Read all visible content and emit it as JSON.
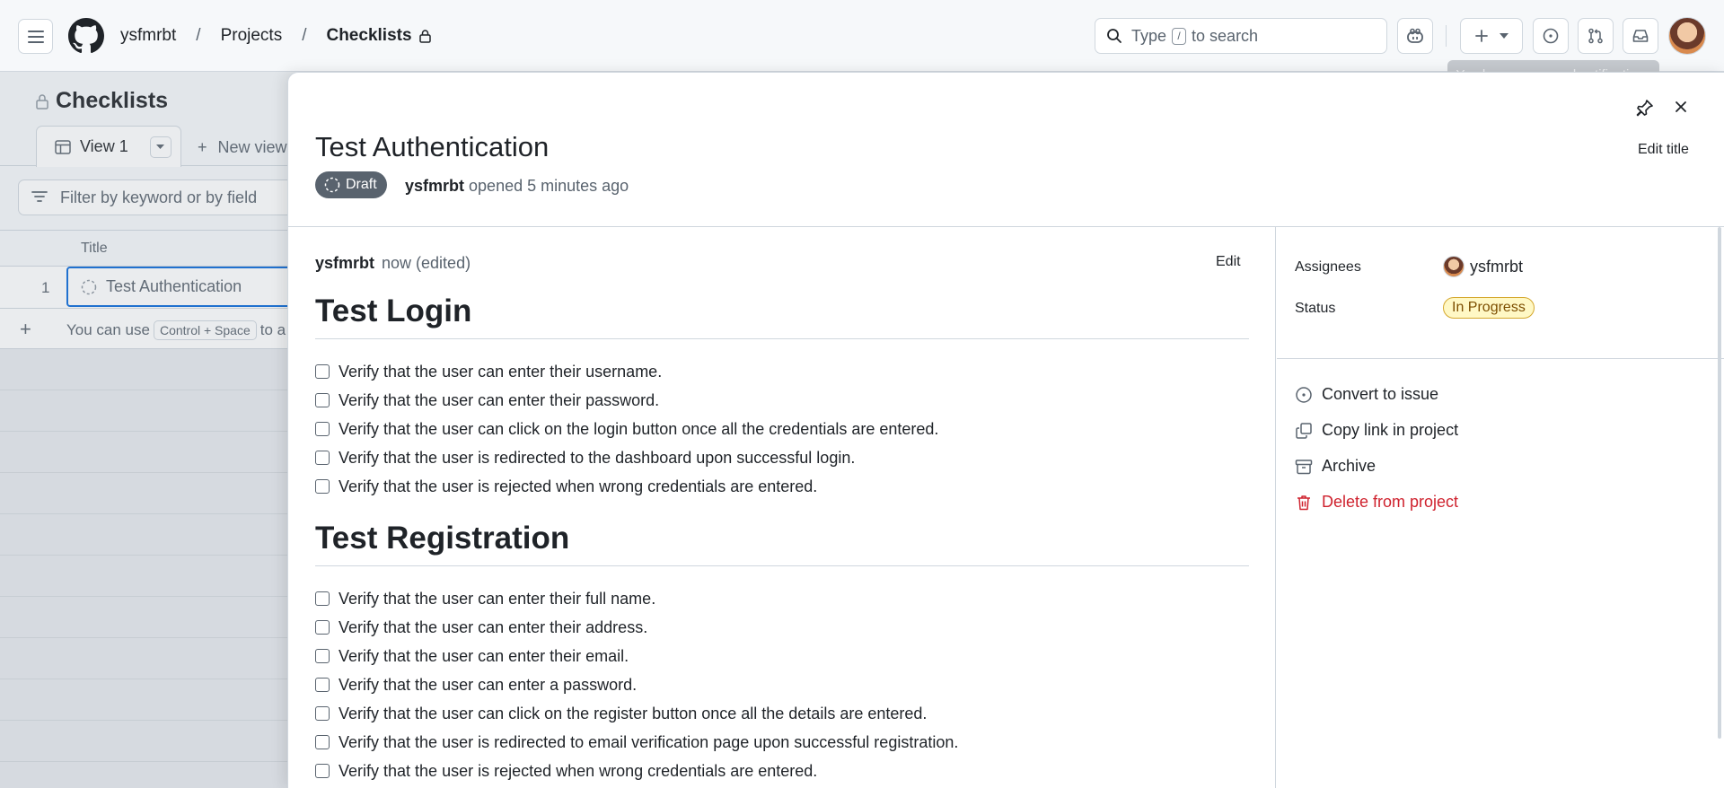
{
  "header": {
    "breadcrumb": [
      "ysfmrbt",
      "Projects",
      "Checklists"
    ],
    "search_prefix": "Type",
    "search_key": "/",
    "search_suffix": "to search",
    "tooltip": "You have no unread notifications"
  },
  "project": {
    "title": "Checklists",
    "view_tab": "View 1",
    "new_view": "New view",
    "filter_placeholder": "Filter by keyword or by field",
    "column_title": "Title",
    "rows": [
      {
        "num": "1",
        "title": "Test Authentication"
      }
    ],
    "hint_prefix": "You can use",
    "hint_key": "Control + Space",
    "hint_suffix": "to a"
  },
  "panel": {
    "title": "Test Authentication",
    "edit_title": "Edit title",
    "status_pill": "Draft",
    "author": "ysfmrbt",
    "opened_text": "opened 5 minutes ago",
    "comment_author": "ysfmrbt",
    "comment_meta": "now (edited)",
    "edit_label": "Edit",
    "sections": [
      {
        "heading": "Test Login",
        "items": [
          "Verify that the user can enter their username.",
          "Verify that the user can enter their password.",
          "Verify that the user can click on the login button once all the credentials are entered.",
          "Verify that the user is redirected to the dashboard upon successful login.",
          "Verify that the user is rejected when wrong credentials are entered."
        ]
      },
      {
        "heading": "Test Registration",
        "items": [
          "Verify that the user can enter their full name.",
          "Verify that the user can enter their address.",
          "Verify that the user can enter their email.",
          "Verify that the user can enter a password.",
          "Verify that the user can click on the register button once all the details are entered.",
          "Verify that the user is redirected to email verification page upon successful registration.",
          "Verify that the user is rejected when wrong credentials are entered."
        ]
      }
    ],
    "sidebar": {
      "assignees_label": "Assignees",
      "assignee": "ysfmrbt",
      "status_label": "Status",
      "status_value": "In Progress",
      "actions": [
        "Convert to issue",
        "Copy link in project",
        "Archive",
        "Delete from project"
      ]
    }
  },
  "colors": {
    "accent": "#0969da",
    "danger": "#cf222e",
    "draft": "#59636e",
    "in_progress_bg": "#fff8c5"
  }
}
